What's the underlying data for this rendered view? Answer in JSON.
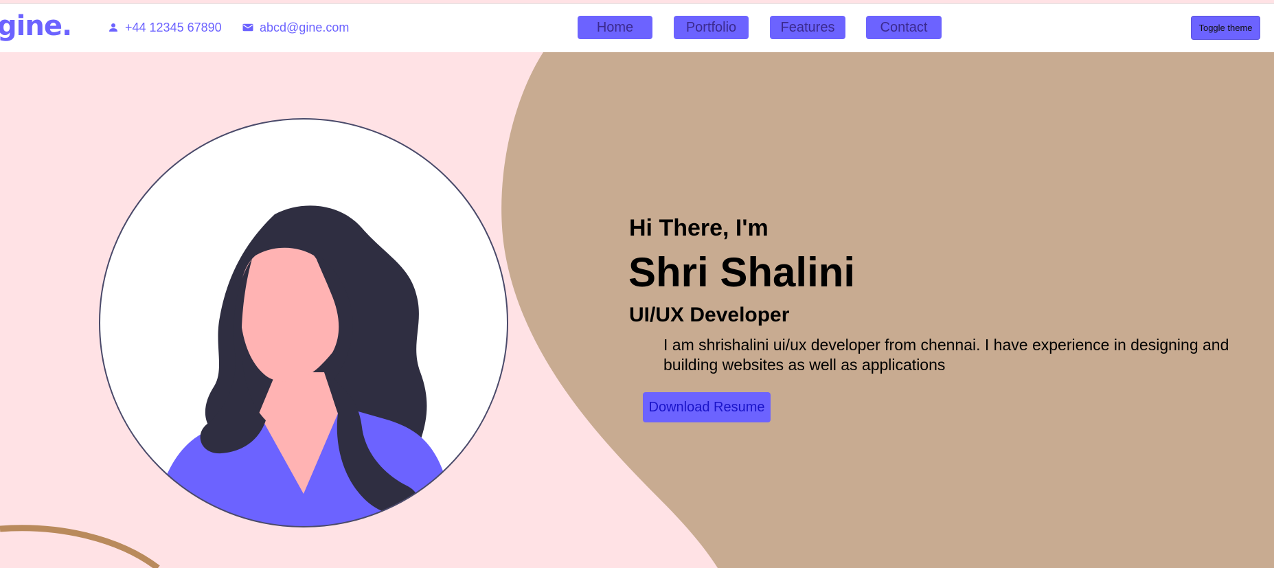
{
  "brand": {
    "logo_text": "gine."
  },
  "header": {
    "phone": "+44 12345 67890",
    "email": "abcd@gine.com",
    "nav": [
      "Home",
      "Portfolio",
      "Features",
      "Contact"
    ],
    "toggle_theme": "Toggle theme"
  },
  "hero": {
    "greeting": "Hi There, I'm",
    "name": "Shri Shalini",
    "role": "UI/UX Developer",
    "description": "I am shrishalini ui/ux developer from chennai. I have experience in designing and building websites as well as applications",
    "resume_button": "Download Resume"
  },
  "colors": {
    "accent": "#6c63ff",
    "hero_pink": "#ffe2e5",
    "hero_tan": "#c8ab91",
    "hair": "#2f2e41",
    "skin": "#ffb3b3"
  },
  "icons": {
    "phone": "person-icon",
    "email": "mail-icon"
  }
}
